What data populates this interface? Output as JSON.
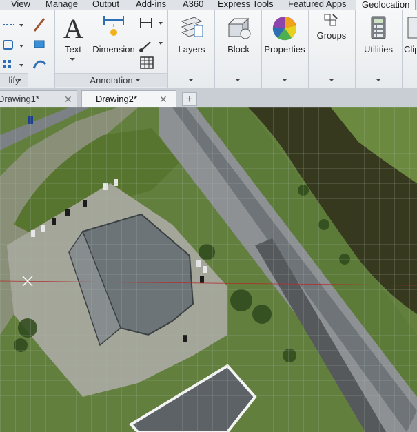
{
  "ribbon_tabs": [
    "View",
    "Manage",
    "Output",
    "Add-ins",
    "A360",
    "Express Tools",
    "Featured Apps",
    "Geolocation"
  ],
  "active_ribbon_tab": "Geolocation",
  "panels": {
    "modify_title": "lify",
    "annotation_title": "Annotation"
  },
  "buttons": {
    "text": "Text",
    "dimension": "Dimension",
    "layers": "Layers",
    "block": "Block",
    "properties": "Properties",
    "groups": "Groups",
    "utilities": "Utilities",
    "clipboard": "Clip"
  },
  "doc_tabs": [
    {
      "label": "Drawing1*",
      "active": false
    },
    {
      "label": "Drawing2*",
      "active": true
    }
  ],
  "new_tab_glyph": "+",
  "close_glyph": "✕",
  "colors": {
    "ribbon_bg": "#f0f2f4",
    "water": "#3a3a22",
    "grass": "#5f7d3a",
    "road": "#6f7478",
    "grid": "#9fb0a6",
    "crosshair": "#b03030"
  },
  "icons": [
    "line-icon",
    "circle-icon",
    "polygon-icon",
    "text-icon",
    "dimension-icon",
    "layers-icon",
    "block-icon",
    "properties-icon",
    "groups-icon",
    "utilities-icon",
    "table-icon"
  ]
}
